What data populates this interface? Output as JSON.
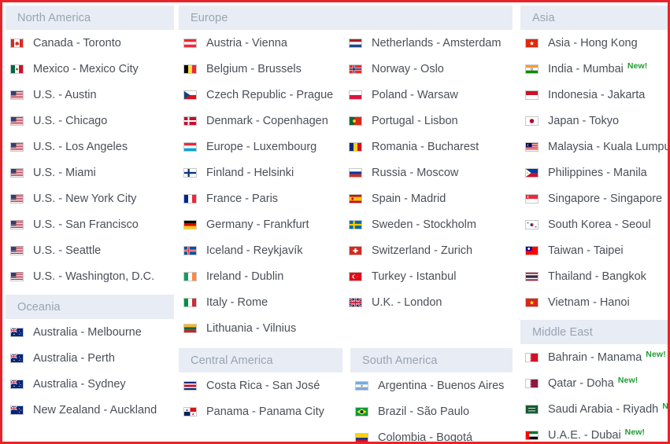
{
  "theme": {
    "border_color": "#e8232a",
    "header_bg": "#e8ecf4",
    "header_text": "#9aa4b3",
    "item_text": "#4a4f58",
    "badge_color": "#1f9d2f"
  },
  "badge": {
    "new_label": "New!"
  },
  "groups": {
    "north_america": {
      "title": "North America",
      "items": [
        {
          "label": "Canada - Toronto",
          "flag": "flag-ca",
          "new": false
        },
        {
          "label": "Mexico - Mexico City",
          "flag": "flag-mx",
          "new": false
        },
        {
          "label": "U.S. - Austin",
          "flag": "flag-us",
          "new": false
        },
        {
          "label": "U.S. - Chicago",
          "flag": "flag-us",
          "new": false
        },
        {
          "label": "U.S. - Los Angeles",
          "flag": "flag-us",
          "new": false
        },
        {
          "label": "U.S. - Miami",
          "flag": "flag-us",
          "new": false
        },
        {
          "label": "U.S. - New York City",
          "flag": "flag-us",
          "new": false
        },
        {
          "label": "U.S. - San Francisco",
          "flag": "flag-us",
          "new": false
        },
        {
          "label": "U.S. - Seattle",
          "flag": "flag-us",
          "new": false
        },
        {
          "label": "U.S. - Washington, D.C.",
          "flag": "flag-us",
          "new": false
        }
      ]
    },
    "oceania": {
      "title": "Oceania",
      "items": [
        {
          "label": "Australia - Melbourne",
          "flag": "flag-au",
          "new": false
        },
        {
          "label": "Australia - Perth",
          "flag": "flag-au",
          "new": false
        },
        {
          "label": "Australia - Sydney",
          "flag": "flag-au",
          "new": false
        },
        {
          "label": "New Zealand - Auckland",
          "flag": "flag-nz",
          "new": false
        }
      ]
    },
    "europe": {
      "title": "Europe",
      "items_col1": [
        {
          "label": "Austria - Vienna",
          "flag": "flag-at",
          "new": false
        },
        {
          "label": "Belgium - Brussels",
          "flag": "flag-be",
          "new": false
        },
        {
          "label": "Czech Republic - Prague",
          "flag": "flag-cz",
          "new": false
        },
        {
          "label": "Denmark - Copenhagen",
          "flag": "flag-dk",
          "new": false
        },
        {
          "label": "Europe - Luxembourg",
          "flag": "flag-lu",
          "new": false
        },
        {
          "label": "Finland - Helsinki",
          "flag": "flag-fi",
          "new": false
        },
        {
          "label": "France - Paris",
          "flag": "flag-fr",
          "new": false
        },
        {
          "label": "Germany - Frankfurt",
          "flag": "flag-de",
          "new": false
        },
        {
          "label": "Iceland - Reykjavík",
          "flag": "flag-is",
          "new": false
        },
        {
          "label": "Ireland - Dublin",
          "flag": "flag-ie",
          "new": false
        },
        {
          "label": "Italy - Rome",
          "flag": "flag-it",
          "new": false
        },
        {
          "label": "Lithuania - Vilnius",
          "flag": "flag-lt",
          "new": false
        }
      ],
      "items_col2": [
        {
          "label": "Netherlands - Amsterdam",
          "flag": "flag-nl",
          "new": false
        },
        {
          "label": "Norway - Oslo",
          "flag": "flag-no",
          "new": false
        },
        {
          "label": "Poland - Warsaw",
          "flag": "flag-pl",
          "new": false
        },
        {
          "label": "Portugal - Lisbon",
          "flag": "flag-pt",
          "new": false
        },
        {
          "label": "Romania - Bucharest",
          "flag": "flag-ro",
          "new": false
        },
        {
          "label": "Russia - Moscow",
          "flag": "flag-ru",
          "new": false
        },
        {
          "label": "Spain - Madrid",
          "flag": "flag-es",
          "new": false
        },
        {
          "label": "Sweden - Stockholm",
          "flag": "flag-se",
          "new": false
        },
        {
          "label": "Switzerland - Zurich",
          "flag": "flag-ch",
          "new": false
        },
        {
          "label": "Turkey - Istanbul",
          "flag": "flag-tr",
          "new": false
        },
        {
          "label": "U.K. - London",
          "flag": "flag-gb",
          "new": false
        }
      ]
    },
    "central_america": {
      "title": "Central America",
      "items": [
        {
          "label": "Costa Rica - San José",
          "flag": "flag-cr",
          "new": false
        },
        {
          "label": "Panama - Panama City",
          "flag": "flag-pa",
          "new": false
        }
      ]
    },
    "south_america": {
      "title": "South America",
      "items": [
        {
          "label": "Argentina - Buenos Aires",
          "flag": "flag-ar",
          "new": false
        },
        {
          "label": "Brazil - São Paulo",
          "flag": "flag-br",
          "new": false
        },
        {
          "label": "Colombia - Bogotá",
          "flag": "flag-co",
          "new": false
        }
      ]
    },
    "asia": {
      "title": "Asia",
      "items": [
        {
          "label": "Asia - Hong Kong",
          "flag": "flag-hk",
          "new": false
        },
        {
          "label": "India - Mumbai",
          "flag": "flag-in",
          "new": true
        },
        {
          "label": "Indonesia - Jakarta",
          "flag": "flag-id",
          "new": false
        },
        {
          "label": "Japan - Tokyo",
          "flag": "flag-jp",
          "new": false
        },
        {
          "label": "Malaysia - Kuala Lumpur",
          "flag": "flag-my",
          "new": false
        },
        {
          "label": "Philippines - Manila",
          "flag": "flag-ph",
          "new": false
        },
        {
          "label": "Singapore - Singapore",
          "flag": "flag-sg",
          "new": false
        },
        {
          "label": "South Korea - Seoul",
          "flag": "flag-kr",
          "new": false
        },
        {
          "label": "Taiwan - Taipei",
          "flag": "flag-tw",
          "new": false
        },
        {
          "label": "Thailand - Bangkok",
          "flag": "flag-th",
          "new": false
        },
        {
          "label": "Vietnam - Hanoi",
          "flag": "flag-vn",
          "new": false
        }
      ]
    },
    "middle_east": {
      "title": "Middle East",
      "items": [
        {
          "label": "Bahrain - Manama",
          "flag": "flag-bh",
          "new": true
        },
        {
          "label": "Qatar - Doha",
          "flag": "flag-qa",
          "new": true
        },
        {
          "label": "Saudi Arabia - Riyadh",
          "flag": "flag-sa",
          "new": true
        },
        {
          "label": "U.A.E. - Dubai",
          "flag": "flag-ae",
          "new": true
        }
      ]
    }
  }
}
